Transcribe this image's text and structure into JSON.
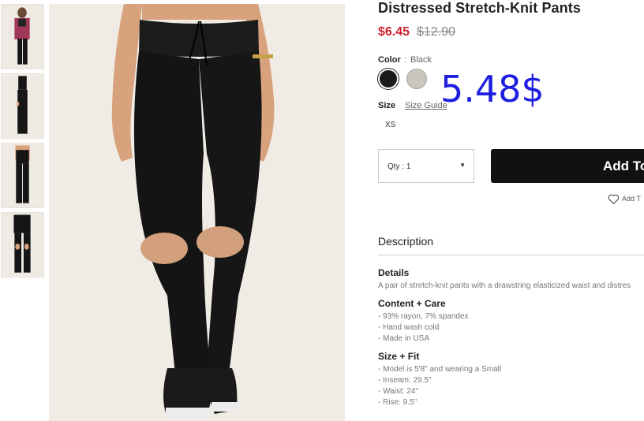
{
  "product": {
    "title": "Distressed Stretch-Knit Pants",
    "sale_price": "$6.45",
    "original_price": "$12.90",
    "overlay_price": "5.48$"
  },
  "color": {
    "label": "Color",
    "separator": ":",
    "selected": "Black",
    "swatches": [
      {
        "name": "Black",
        "hex": "#1a1a1a"
      },
      {
        "name": "Heather Grey",
        "hex": "#c9c6be"
      }
    ]
  },
  "size": {
    "label": "Size",
    "guide_link": "Size Guide",
    "options": [
      "XS"
    ]
  },
  "quantity": {
    "label": "Qty : 1"
  },
  "cart": {
    "add_label": "Add To"
  },
  "wishlist": {
    "label": "Add T"
  },
  "description": {
    "heading": "Description",
    "details": {
      "heading": "Details",
      "text": "A pair of stretch-knit pants with a drawstring elasticized waist and distres"
    },
    "content_care": {
      "heading": "Content + Care",
      "lines": [
        "- 93% rayon, 7% spandex",
        "- Hand wash cold",
        "- Made in USA"
      ]
    },
    "size_fit": {
      "heading": "Size + Fit",
      "lines": [
        "- Model is 5'8\" and wearing a Small",
        "- Inseam: 29.5\"",
        "- Waist: 24\"",
        "- Rise: 9.5\""
      ]
    }
  },
  "colors": {
    "sale": "#d2202f",
    "button": "#111111",
    "overlay": "#1e1ee0"
  }
}
